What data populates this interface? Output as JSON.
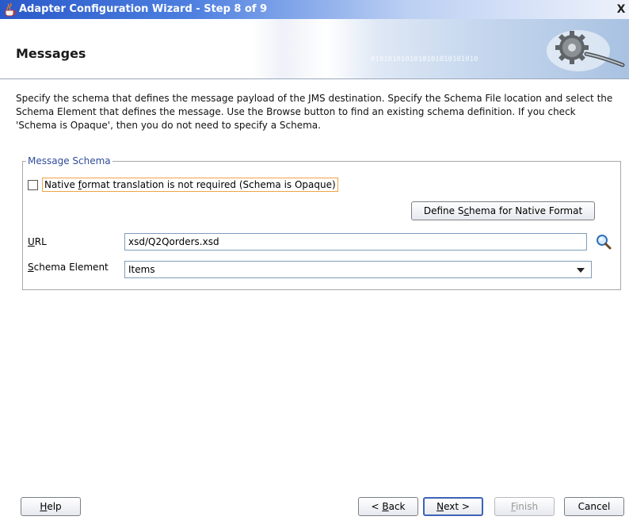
{
  "window": {
    "title": "Adapter Configuration Wizard - Step 8 of 9",
    "close_glyph": "X"
  },
  "header": {
    "title": "Messages",
    "decor_binary": "0101010101010101010101010"
  },
  "description": "Specify the schema that defines the message payload of the JMS destination.  Specify the Schema File location and select the Schema Element that defines the message. Use the Browse button to find an existing schema definition. If you check 'Schema is Opaque', then you do not need to specify a Schema.",
  "message_schema": {
    "legend": "Message Schema",
    "opaque_checkbox": {
      "label_pre": "Native ",
      "label_mnemonic": "f",
      "label_post": "ormat translation is not required (Schema is Opaque)",
      "checked": false
    },
    "define_button": {
      "pre": "Define S",
      "mnemonic": "c",
      "post": "hema for Native Format"
    },
    "url": {
      "label_mnemonic": "U",
      "label_post": "RL",
      "value": "xsd/Q2Qorders.xsd"
    },
    "schema_element": {
      "label_mnemonic": "S",
      "label_post": "chema Element",
      "selected": "Items"
    }
  },
  "footer": {
    "help": {
      "mnemonic": "H",
      "post": "elp"
    },
    "back": {
      "pre": "< ",
      "mnemonic": "B",
      "post": "ack"
    },
    "next": {
      "mnemonic": "N",
      "post": "ext >"
    },
    "finish": {
      "mnemonic": "F",
      "post": "inish",
      "enabled": false
    },
    "cancel": "Cancel"
  },
  "colors": {
    "title_bar": "#2a59c9",
    "legend_text": "#2f4d9a",
    "focus_outline": "#f0a347",
    "default_button_border": "#3c63b6"
  }
}
